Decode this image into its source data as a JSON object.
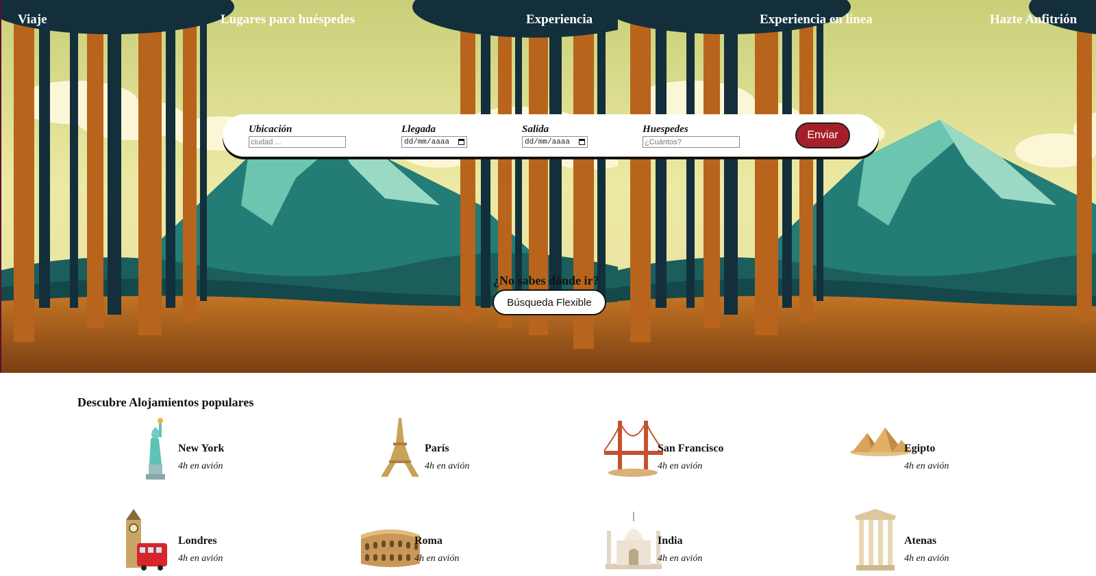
{
  "nav": {
    "items": [
      "Viaje",
      "Lugares para huéspedes",
      "Experiencia",
      "Experiencia en línea",
      "Hazte Anfitrión"
    ]
  },
  "search": {
    "location_label": "Ubicación",
    "location_placeholder": "ciudad ...",
    "arrival_label": "Llegada",
    "arrival_value": "dd/mm/aaaa",
    "departure_label": "Salida",
    "departure_value": "dd/mm/aaaa",
    "guests_label": "Huespedes",
    "guests_placeholder": "¿Cuántos?",
    "submit_label": "Enviar"
  },
  "flexible": {
    "question": "¿No sabes dónde ir?",
    "button_label": "Búsqueda Flexible"
  },
  "popular": {
    "title": "Descubre Alojamientos populares",
    "destinations": [
      {
        "name": "New York",
        "time": "4h en avión",
        "icon": "statue-of-liberty-icon"
      },
      {
        "name": "París",
        "time": "4h en avión",
        "icon": "eiffel-tower-icon"
      },
      {
        "name": "San Francisco",
        "time": "4h en avión",
        "icon": "golden-gate-bridge-icon"
      },
      {
        "name": "Egipto",
        "time": "4h en avión",
        "icon": "pyramids-icon"
      },
      {
        "name": "Londres",
        "time": "4h en avión",
        "icon": "big-ben-icon"
      },
      {
        "name": "Roma",
        "time": "4h en avión",
        "icon": "colosseum-icon"
      },
      {
        "name": "India",
        "time": "4h en avión",
        "icon": "taj-mahal-icon"
      },
      {
        "name": "Atenas",
        "time": "4h en avión",
        "icon": "greek-temple-icon"
      }
    ]
  },
  "colors": {
    "accent": "#a51f2a",
    "sky": "#e6e49a",
    "mountain": "#2a8f82",
    "trunk": "#b8641c",
    "ground": "#8c4e18"
  }
}
